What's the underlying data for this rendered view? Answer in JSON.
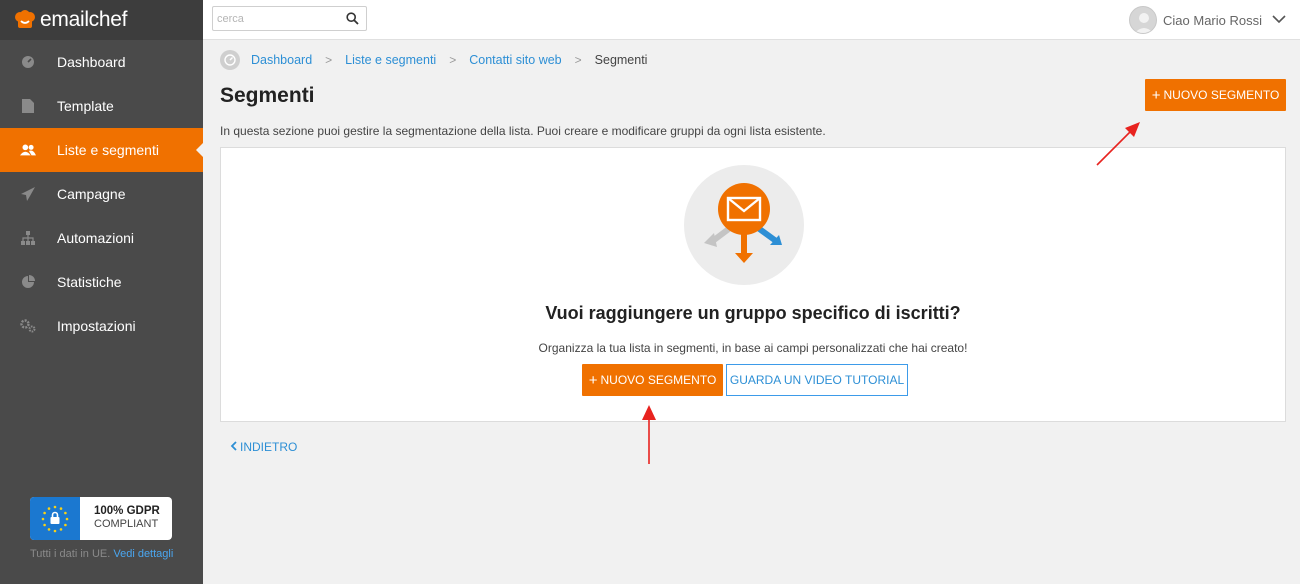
{
  "brand": {
    "name": "emailchef",
    "accent": "#f07100",
    "link": "#2d8fd5"
  },
  "sidebar": {
    "items": [
      {
        "label": "Dashboard",
        "icon": "dashboard-icon",
        "active": false
      },
      {
        "label": "Template",
        "icon": "document-icon",
        "active": false
      },
      {
        "label": "Liste e segmenti",
        "icon": "users-icon",
        "active": true
      },
      {
        "label": "Campagne",
        "icon": "paper-plane-icon",
        "active": false
      },
      {
        "label": "Automazioni",
        "icon": "sitemap-icon",
        "active": false
      },
      {
        "label": "Statistiche",
        "icon": "pie-chart-icon",
        "active": false
      },
      {
        "label": "Impostazioni",
        "icon": "gears-icon",
        "active": false
      }
    ],
    "gdpr": {
      "title": "100% GDPR",
      "subtitle": "COMPLIANT",
      "footer": "Tutti i dati in UE.",
      "footer_link": "Vedi dettagli"
    }
  },
  "topbar": {
    "search_placeholder": "cerca",
    "user_greeting": "Ciao Mario Rossi"
  },
  "breadcrumb": {
    "items": [
      "Dashboard",
      "Liste e segmenti",
      "Contatti sito web"
    ],
    "current": "Segmenti"
  },
  "page": {
    "title": "Segmenti",
    "new_segment_label": "NUOVO SEGMENTO",
    "description": "In questa sezione puoi gestire la segmentazione della lista. Puoi creare e modificare gruppi da ogni lista esistente."
  },
  "empty_state": {
    "title": "Vuoi raggiungere un gruppo specifico di iscritti?",
    "subtitle": "Organizza la tua lista in segmenti, in base ai campi personalizzati che hai creato!",
    "primary_label": "NUOVO SEGMENTO",
    "secondary_label": "GUARDA UN VIDEO TUTORIAL"
  },
  "back_label": "INDIETRO"
}
